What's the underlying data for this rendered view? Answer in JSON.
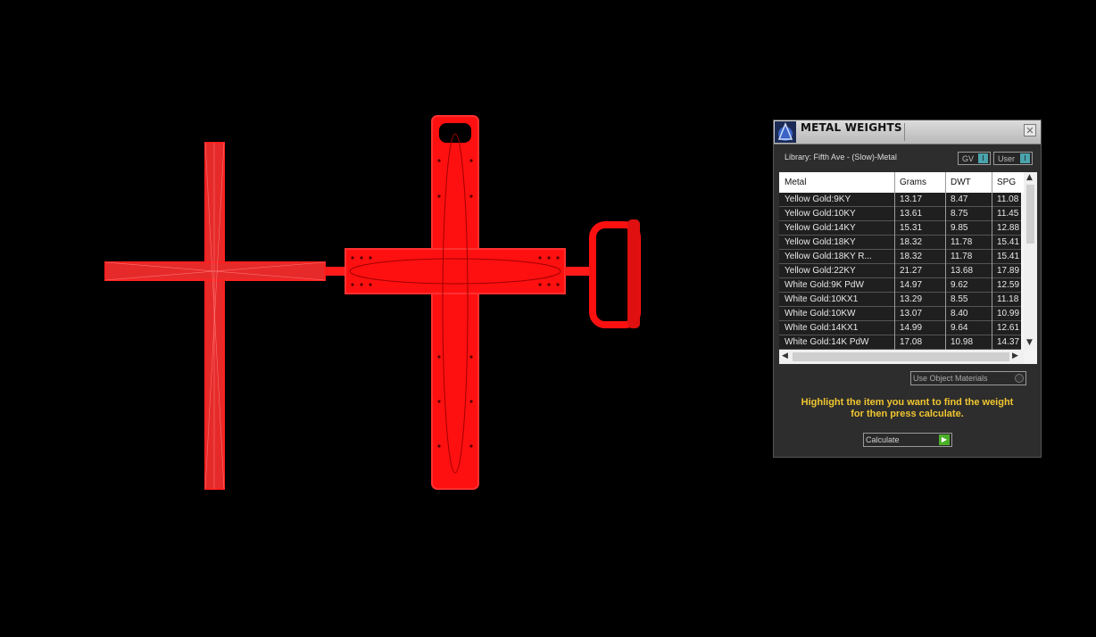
{
  "window": {
    "title": "METAL WEIGHTS",
    "close_icon": "close-icon",
    "logo_icon": "app-logo-icon"
  },
  "library": {
    "label": "Library: Fifth Ave - (Slow)-Metal"
  },
  "toggles": [
    {
      "label": "GV",
      "knob": "I"
    },
    {
      "label": "User",
      "knob": "I"
    }
  ],
  "table": {
    "headers": [
      "Metal",
      "Grams",
      "DWT",
      "SPG"
    ],
    "rows": [
      [
        "Yellow Gold:9KY",
        "13.17",
        "8.47",
        "11.08"
      ],
      [
        "Yellow Gold:10KY",
        "13.61",
        "8.75",
        "11.45"
      ],
      [
        "Yellow Gold:14KY",
        "15.31",
        "9.85",
        "12.88"
      ],
      [
        "Yellow Gold:18KY",
        "18.32",
        "11.78",
        "15.41"
      ],
      [
        "Yellow Gold:18KY R...",
        "18.32",
        "11.78",
        "15.41"
      ],
      [
        "Yellow Gold:22KY",
        "21.27",
        "13.68",
        "17.89"
      ],
      [
        "White Gold:9K PdW",
        "14.97",
        "9.62",
        "12.59"
      ],
      [
        "White Gold:10KX1",
        "13.29",
        "8.55",
        "11.18"
      ],
      [
        "White Gold:10KW",
        "13.07",
        "8.40",
        "10.99"
      ],
      [
        "White Gold:14KX1",
        "14.99",
        "9.64",
        "12.61"
      ],
      [
        "White Gold:14K PdW",
        "17.08",
        "10.98",
        "14.37"
      ]
    ]
  },
  "use_object_materials": {
    "label": "Use Object Materials"
  },
  "hint": {
    "line1": "Highlight the item you want to find the weight",
    "line2": "for then press calculate."
  },
  "calculate": {
    "label": "Calculate",
    "icon": "play-arrow-icon"
  },
  "viewport": {
    "model_color": "#ff0000",
    "background": "#000000"
  }
}
